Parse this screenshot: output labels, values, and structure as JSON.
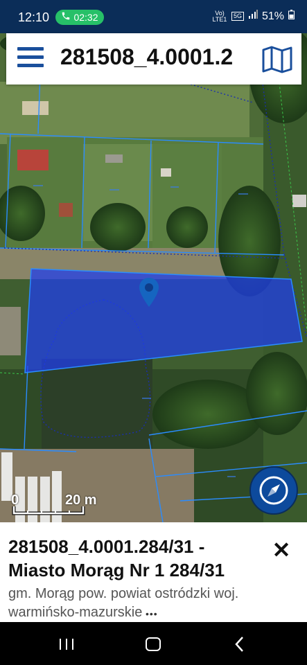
{
  "status_bar": {
    "time": "12:10",
    "call_timer": "02:32",
    "network_volte": "Vo) LTE1",
    "network_5g": "5G",
    "battery": "51%"
  },
  "top_bar": {
    "title": "281508_4.0001.2"
  },
  "map": {
    "scale_zero": "0",
    "scale_distance": "20 m",
    "parcel_color": "#1f3df0",
    "boundary_color": "#2a8cff",
    "marker_color": "#1565c0"
  },
  "info_panel": {
    "title": "281508_4.0001.284/31 - Miasto Morąg Nr 1 284/31",
    "subtitle": "gm. Morąg  pow. powiat ostródzki woj. warmińsko-mazurskie",
    "close_symbol": "✕",
    "drag_handle": "•••"
  },
  "icons": {
    "menu": "hamburger-menu-icon",
    "map_toggle": "folded-map-icon",
    "compass": "compass-navigation-icon",
    "call": "phone-icon",
    "location_marker": "map-pin-icon"
  }
}
